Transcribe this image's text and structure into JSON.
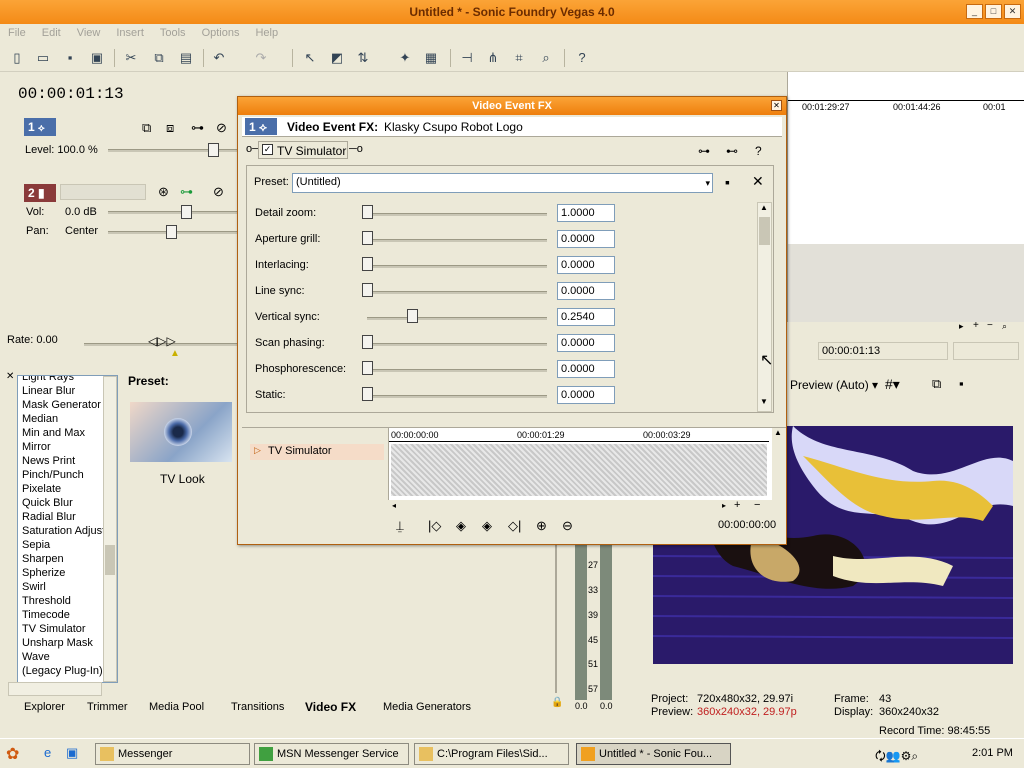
{
  "window": {
    "title": "Untitled * - Sonic Foundry Vegas 4.0"
  },
  "menu": [
    "File",
    "Edit",
    "View",
    "Insert",
    "Tools",
    "Options",
    "Help"
  ],
  "timeline": {
    "timecode": "00:00:01:13",
    "ruler": [
      "00:01:29:27",
      "00:01:44:26",
      "00:01"
    ],
    "cursor_time": "00:00:01:13",
    "rate_label": "Rate: 0.00"
  },
  "tracks": {
    "video": {
      "number": "1",
      "level_label": "Level: 100.0 %"
    },
    "audio": {
      "number": "2",
      "vol_label": "Vol:",
      "vol_value": "0.0 dB",
      "pan_label": "Pan:",
      "pan_value": "Center"
    }
  },
  "dialog": {
    "title": "Video Event FX",
    "header_num": "1",
    "header_label": "Video Event FX:",
    "header_name": "Klasky Csupo Robot Logo",
    "plugin_tab": "TV Simulator",
    "preset_label": "Preset:",
    "preset_value": "(Untitled)",
    "params": [
      {
        "label": "Detail zoom:",
        "value": "1.0000",
        "level": 0.0
      },
      {
        "label": "Aperture grill:",
        "value": "0.0000",
        "level": 0.0
      },
      {
        "label": "Interlacing:",
        "value": "0.0000",
        "level": 0.0
      },
      {
        "label": "Line sync:",
        "value": "0.0000",
        "level": 0.0
      },
      {
        "label": "Vertical sync:",
        "value": "0.2540",
        "level": 0.25
      },
      {
        "label": "Scan phasing:",
        "value": "0.0000",
        "level": 0.0
      },
      {
        "label": "Phosphorescence:",
        "value": "0.0000",
        "level": 0.0
      },
      {
        "label": "Static:",
        "value": "0.0000",
        "level": 0.0
      }
    ],
    "keyframe_track": "TV Simulator",
    "kf_ruler": [
      "00:00:00:00",
      "00:00:01:29",
      "00:00:03:29"
    ],
    "kf_time": "00:00:00:00"
  },
  "fx_browser": {
    "items": [
      "Light Rays",
      "Linear Blur",
      "Mask Generator",
      "Median",
      "Min and Max",
      "Mirror",
      "News Print",
      "Pinch/Punch",
      "Pixelate",
      "Quick Blur",
      "Radial Blur",
      "Saturation Adjust",
      "Sepia",
      "Sharpen",
      "Spherize",
      "Swirl",
      "Threshold",
      "Timecode",
      "TV Simulator",
      "Unsharp Mask",
      "Wave",
      "(Legacy Plug-In)"
    ],
    "preset_label": "Preset:",
    "preset_name": "TV Look"
  },
  "tabs": [
    "Explorer",
    "Trimmer",
    "Media Pool",
    "Transitions",
    "Video FX",
    "Media Generators"
  ],
  "active_tab": "Video FX",
  "meter": {
    "ticks": [
      "27",
      "33",
      "39",
      "45",
      "51",
      "57"
    ],
    "left": "0.0",
    "right": "0.0"
  },
  "preview": {
    "mode": "Preview (Auto)",
    "project_label": "Project:",
    "project_value": "720x480x32, 29.97i",
    "preview_label": "Preview:",
    "preview_value": "360x240x32, 29.97p",
    "frame_label": "Frame:",
    "frame_value": "43",
    "display_label": "Display:",
    "display_value": "360x240x32"
  },
  "record_time": "Record Time: 98:45:55",
  "taskbar": {
    "buttons": [
      "Messenger",
      "MSN Messenger Service",
      "C:\\Program Files\\Sid...",
      "Untitled * - Sonic Fou..."
    ],
    "clock": "2:01 PM"
  },
  "colors": {
    "title_orange": "#f48a16",
    "track_video": "#4a6ea9",
    "track_audio": "#8a3a3a",
    "preview_bg": "#2a1a6a"
  }
}
